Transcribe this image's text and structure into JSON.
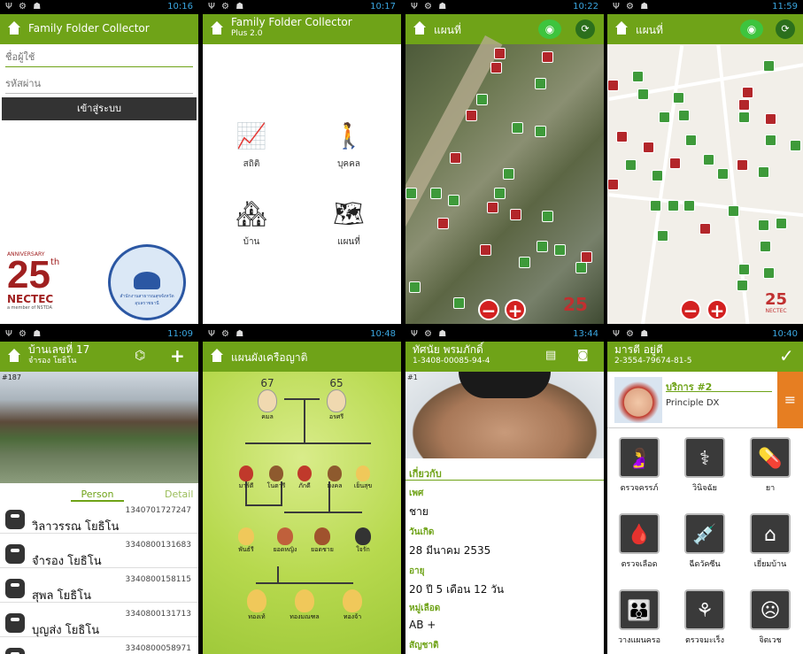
{
  "s1": {
    "status": {
      "icons": "Ψ ⚙ ☗",
      "time": "10:16"
    },
    "title": "Family Folder Collector",
    "username_placeholder": "ชื่อผู้ใช้",
    "password_placeholder": "รหัสผ่าน",
    "login_label": "เข้าสู่ระบบ",
    "anniv": "ANNIVERSARY",
    "num": "25",
    "th": "th",
    "nectec": "NECTEC",
    "member": "a member of NSTDA",
    "seal_text": "สำนักงานสาธารณสุขจังหวัด อุบลราชธานี"
  },
  "s2": {
    "status": {
      "icons": "Ψ ⚙ ☗",
      "time": "10:17"
    },
    "title": "Family Folder Collector",
    "subtitle": "Plus 2.0",
    "items": [
      {
        "label": "สถิติ",
        "icon": "chart-icon"
      },
      {
        "label": "บุคคล",
        "icon": "person-icon"
      },
      {
        "label": "บ้าน",
        "icon": "house-icon"
      },
      {
        "label": "แผนที่",
        "icon": "map-icon"
      }
    ]
  },
  "s3": {
    "status": {
      "icons": "Ψ ⚙ ☗",
      "time": "10:22"
    },
    "title": "แผนที่",
    "logo": "25"
  },
  "s4": {
    "status": {
      "icons": "Ψ ⚙ ☗",
      "time": "11:59"
    },
    "title": "แผนที่",
    "logo": "25",
    "logo_sub": "NECTEC"
  },
  "s5": {
    "status": {
      "icons": "Ψ ⚙ ☗",
      "time": "11:09"
    },
    "title": "บ้านเลขที่ 17",
    "subtitle": "จำรอง โยธิโน",
    "photo_tag": "#187",
    "tab_person": "Person",
    "tab_detail": "Detail",
    "rows": [
      {
        "id": "1340701727247",
        "name": "วิลาวรรณ โยธิโน"
      },
      {
        "id": "3340800131683",
        "name": "จำรอง โยธิโน"
      },
      {
        "id": "3340800158115",
        "name": "สุพล โยธิโน"
      },
      {
        "id": "3340800131713",
        "name": "บุญส่ง โยธิโน"
      },
      {
        "id": "3340800058971",
        "name": ""
      }
    ]
  },
  "s6": {
    "status": {
      "icons": "Ψ ⚙ ☗",
      "time": "10:48"
    },
    "title": "แผนผังเครือญาติ",
    "age_left": "67",
    "age_right": "65",
    "gp_left": "คมล",
    "gp_right": "อรศรี",
    "gen2": [
      "มาร์ตี",
      "โนตารี",
      "ภักดี",
      "มงคล",
      "เย็นสุข"
    ],
    "gen3": [
      "พันธ์รี",
      "ยอดหญิง",
      "ยอดชาย",
      "ใจรัก"
    ],
    "gen4": [
      "ทองเท้",
      "ทองมณฑล",
      "ทองจ้า"
    ]
  },
  "s7": {
    "status": {
      "icons": "Ψ ⚙ ☗",
      "time": "13:44"
    },
    "title": "ทัศนัย พรมภักดิ์",
    "subtitle": "1-3408-00085-94-4",
    "photo_tag": "#1",
    "section": "เกี่ยวกับ",
    "fields": [
      {
        "k": "เพศ",
        "v": "ชาย"
      },
      {
        "k": "วันเกิด",
        "v": "28 มีนาคม 2535"
      },
      {
        "k": "อายุ",
        "v": "20 ปี 5 เดือน 12 วัน"
      },
      {
        "k": "หมู่เลือด",
        "v": "AB +"
      },
      {
        "k": "สัญชาติ",
        "v": ""
      }
    ]
  },
  "s8": {
    "status": {
      "icons": "Ψ ⚙ ☗",
      "time": "10:40"
    },
    "title": "มารตี อยู่ดี",
    "subtitle": "2-3554-79674-81-5",
    "service": "บริการ #2",
    "principle": "Principle DX",
    "items": [
      {
        "label": "ตรวจครรภ์",
        "icon": "pregnancy-icon"
      },
      {
        "label": "วินิจฉัย",
        "icon": "stethoscope-icon"
      },
      {
        "label": "ยา",
        "icon": "pills-icon"
      },
      {
        "label": "ตรวจเลือด",
        "icon": "blood-icon"
      },
      {
        "label": "ฉีดวัคซีน",
        "icon": "syringe-icon"
      },
      {
        "label": "เยี่ยมบ้าน",
        "icon": "home-visit-icon"
      },
      {
        "label": "วางแผนครอ",
        "icon": "family-icon"
      },
      {
        "label": "ตรวจมะเร็ง",
        "icon": "uterus-icon"
      },
      {
        "label": "จิตเวช",
        "icon": "mental-icon"
      }
    ]
  },
  "colors": {
    "green": "#6fa318",
    "red": "#b3262a"
  }
}
